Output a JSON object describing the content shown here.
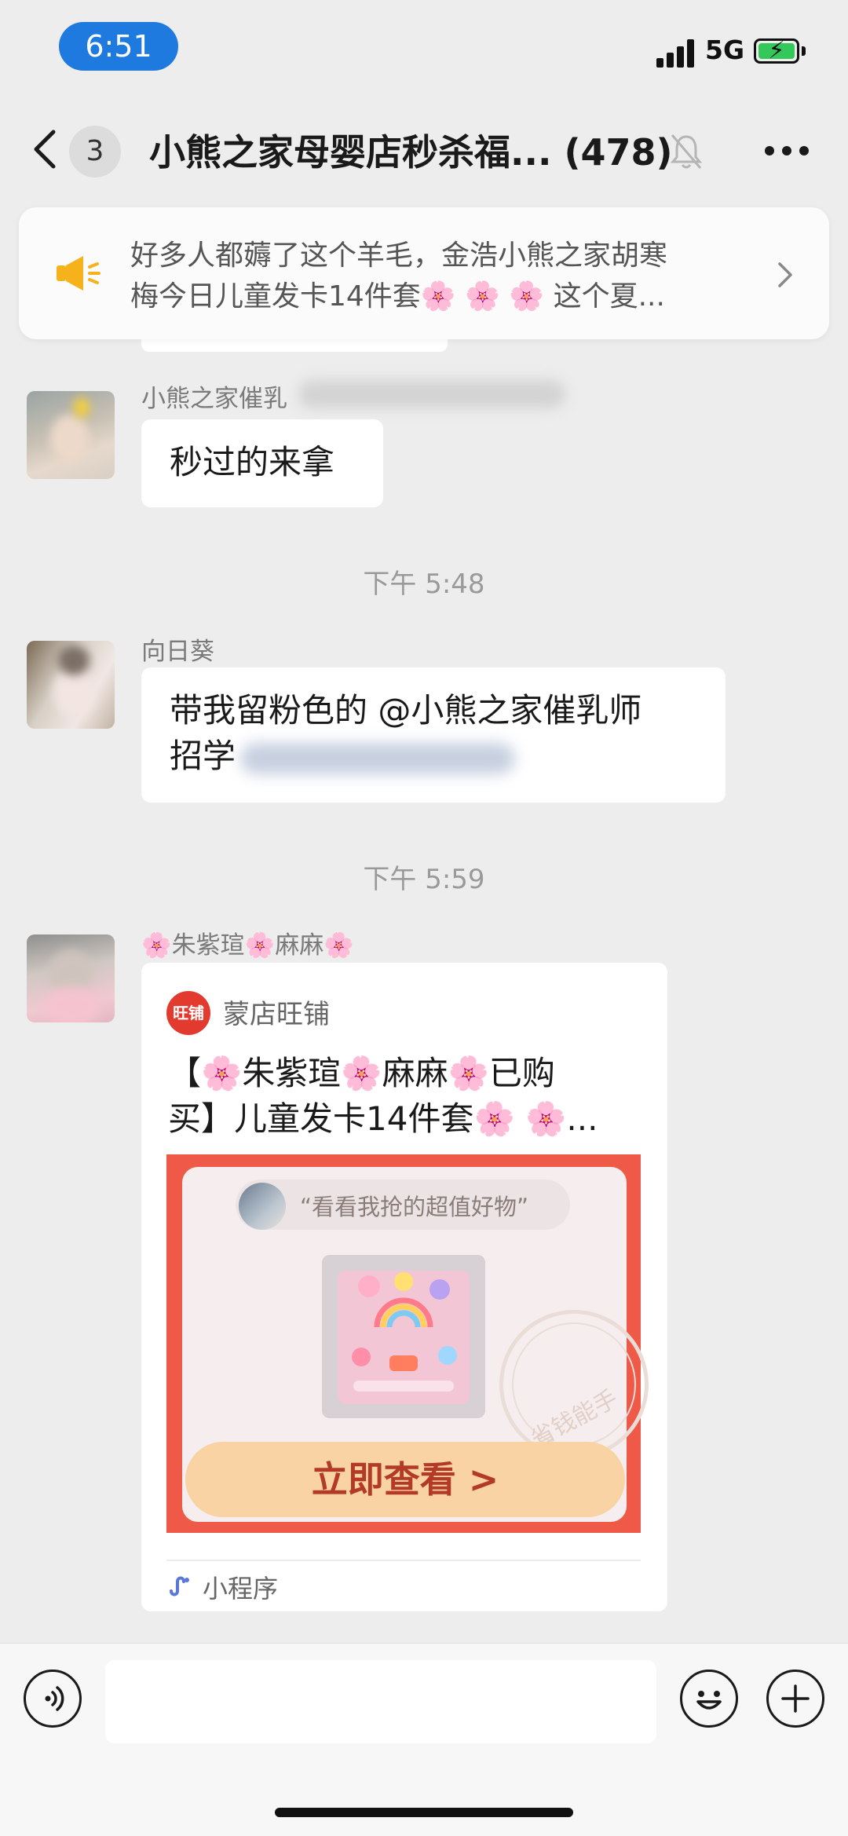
{
  "status_bar": {
    "time": "6:51",
    "network": "5G"
  },
  "header": {
    "unread_count": "3",
    "title": "小熊之家母婴店秒杀福... (478)"
  },
  "announcement": {
    "text_line1": "好多人都薅了这个羊毛，金浩小熊之家胡寒",
    "text_line2": "梅今日儿童发卡14件套🌸 🌸 🌸 这个夏..."
  },
  "messages": [
    {
      "sender": "小熊之家催乳",
      "text": "秒过的来拿"
    },
    {
      "timestamp": "下午 5:48"
    },
    {
      "sender": "向日葵",
      "text_line1": "带我留粉色的 @小熊之家催乳师",
      "text_line2": "招学"
    },
    {
      "timestamp": "下午 5:59"
    },
    {
      "sender": "🌸朱紫瑄🌸麻麻🌸",
      "card": {
        "shop_logo_text": "旺铺",
        "shop_name": "蒙店旺铺",
        "title_line1": "【🌸朱紫瑄🌸麻麻🌸已购",
        "title_line2": "买】儿童发卡14件套🌸 🌸...",
        "pill_text": "“看看我抢的超值好物”",
        "stamp_text": "省钱能手",
        "button_label": "立即查看 >",
        "footer_label": "小程序"
      }
    }
  ],
  "colors": {
    "accent": "#1f7ae0",
    "poster_red": "#ef5a48",
    "button_bg": "#f9d3a4",
    "button_text": "#b33a27"
  }
}
